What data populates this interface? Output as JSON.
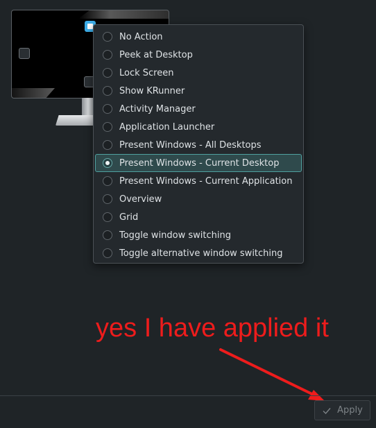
{
  "screen_edge_preview": {
    "edge_buttons": [
      "left-edge",
      "top-left-corner-active",
      "bottom-edge"
    ]
  },
  "menu": {
    "selected_index": 7,
    "items": [
      {
        "label": "No Action"
      },
      {
        "label": "Peek at Desktop"
      },
      {
        "label": "Lock Screen"
      },
      {
        "label": "Show KRunner"
      },
      {
        "label": "Activity Manager"
      },
      {
        "label": "Application Launcher"
      },
      {
        "label": "Present Windows - All Desktops"
      },
      {
        "label": "Present Windows - Current Desktop"
      },
      {
        "label": "Present Windows - Current Application"
      },
      {
        "label": "Overview"
      },
      {
        "label": "Grid"
      },
      {
        "label": "Toggle window switching"
      },
      {
        "label": "Toggle alternative window switching"
      }
    ]
  },
  "annotation": {
    "text": "yes I have applied it",
    "color": "#ee1c1c"
  },
  "footer": {
    "apply_label": "Apply",
    "apply_icon": "checkmark-icon"
  },
  "colors": {
    "background": "#1f2427",
    "selection_border": "#4fa1a0",
    "selection_fill": "#2f4a4c",
    "accent": "#3daee9"
  }
}
